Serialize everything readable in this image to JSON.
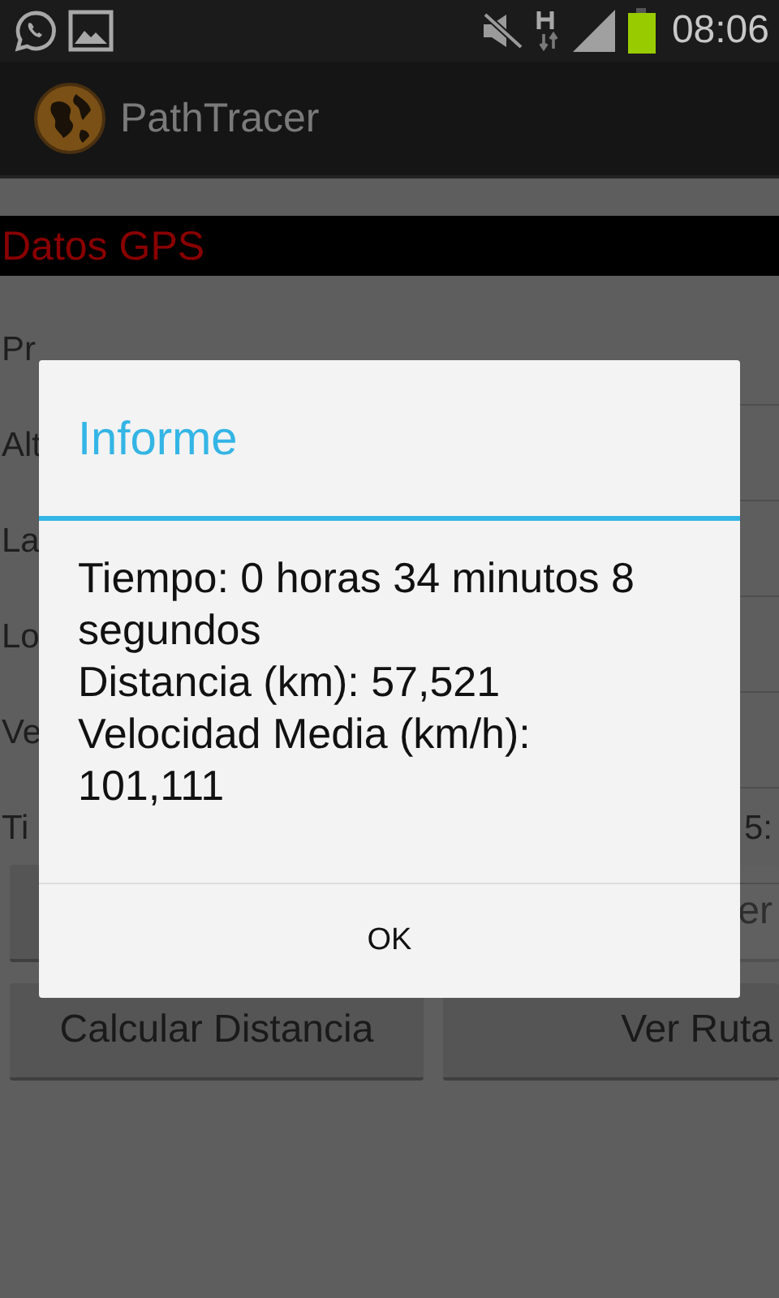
{
  "status_bar": {
    "time": "08:06"
  },
  "action_bar": {
    "title": "PathTracer"
  },
  "screen": {
    "header": "Datos GPS",
    "rows": [
      {
        "label": "Pr"
      },
      {
        "label": "Alt"
      },
      {
        "label": "La"
      },
      {
        "label": "Lo"
      },
      {
        "label": "Ve"
      },
      {
        "label": "Ti",
        "value": "5:"
      }
    ],
    "buttons": [
      [
        {
          "disabled": false
        },
        {
          "label": "er",
          "disabled": true
        }
      ],
      [
        {
          "label": "Calcular Distancia",
          "disabled": false
        },
        {
          "label": "Ver Ruta",
          "disabled": false
        }
      ]
    ]
  },
  "dialog": {
    "title": "Informe",
    "lines": [
      "Tiempo: 0 horas 34 minutos 8 segundos",
      "Distancia (km): 57,521",
      "Velocidad Media (km/h): 101,111"
    ],
    "button": "OK"
  }
}
